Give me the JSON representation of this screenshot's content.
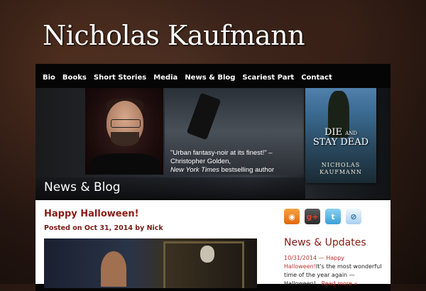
{
  "site": {
    "title": "Nicholas Kaufmann"
  },
  "nav": {
    "items": [
      {
        "label": "Bio"
      },
      {
        "label": "Books"
      },
      {
        "label": "Short Stories"
      },
      {
        "label": "Media"
      },
      {
        "label": "News & Blog"
      },
      {
        "label": "Scariest Part"
      },
      {
        "label": "Contact"
      }
    ]
  },
  "banner": {
    "quote": "\"Urban fantasy-noir at its finest!\" – Christopher Golden,",
    "quote_source": "New York Times",
    "quote_suffix": " bestselling author",
    "book_title_line1": "DIE",
    "book_title_and": "AND",
    "book_title_line2": "STAY DEAD",
    "book_author_line1": "NICHOLAS",
    "book_author_line2": "KAUFMANN",
    "section_title": "News & Blog"
  },
  "post": {
    "title": "Happy Halloween!",
    "meta": "Posted on Oct 31, 2014 by Nick"
  },
  "social": [
    {
      "icon": "rss-icon",
      "glyph": "◉"
    },
    {
      "icon": "google-plus-icon",
      "glyph": "g+"
    },
    {
      "icon": "twitter-icon",
      "glyph": "t"
    },
    {
      "icon": "link-icon",
      "glyph": "⊘"
    }
  ],
  "sidebar": {
    "title": "News & Updates",
    "news_date": "10/31/2014",
    "news_sep": " — ",
    "news_link": "Happy Halloween!",
    "news_text": "It's the most wonderful time of the year again — Halloween!...",
    "read_more": "Read more »"
  },
  "colors": {
    "accent": "#8a1a12",
    "link": "#c0302a",
    "nav_bg": "#050505"
  }
}
